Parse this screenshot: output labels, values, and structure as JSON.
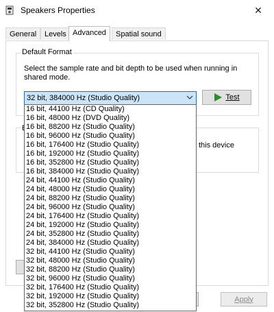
{
  "window": {
    "title": "Speakers Properties",
    "close_glyph": "✕"
  },
  "tabs": [
    {
      "label": "General"
    },
    {
      "label": "Levels"
    },
    {
      "label": "Advanced"
    },
    {
      "label": "Spatial sound"
    }
  ],
  "default_format": {
    "legend": "Default Format",
    "description": "Select the sample rate and bit depth to be used when running in shared mode.",
    "selected": "32 bit, 384000 Hz (Studio Quality)",
    "test_label": "Test"
  },
  "hidden_text": {
    "peek_char": "E",
    "exclusive_fragment": "this device"
  },
  "format_options": [
    "16 bit, 44100 Hz (CD Quality)",
    "16 bit, 48000 Hz (DVD Quality)",
    "16 bit, 88200 Hz (Studio Quality)",
    "16 bit, 96000 Hz (Studio Quality)",
    "16 bit, 176400 Hz (Studio Quality)",
    "16 bit, 192000 Hz (Studio Quality)",
    "16 bit, 352800 Hz (Studio Quality)",
    "16 bit, 384000 Hz (Studio Quality)",
    "24 bit, 44100 Hz (Studio Quality)",
    "24 bit, 48000 Hz (Studio Quality)",
    "24 bit, 88200 Hz (Studio Quality)",
    "24 bit, 96000 Hz (Studio Quality)",
    "24 bit, 176400 Hz (Studio Quality)",
    "24 bit, 192000 Hz (Studio Quality)",
    "24 bit, 352800 Hz (Studio Quality)",
    "24 bit, 384000 Hz (Studio Quality)",
    "32 bit, 44100 Hz (Studio Quality)",
    "32 bit, 48000 Hz (Studio Quality)",
    "32 bit, 88200 Hz (Studio Quality)",
    "32 bit, 96000 Hz (Studio Quality)",
    "32 bit, 176400 Hz (Studio Quality)",
    "32 bit, 192000 Hz (Studio Quality)",
    "32 bit, 352800 Hz (Studio Quality)"
  ],
  "footer": {
    "apply_label": "Apply"
  },
  "icons": {
    "app": "speaker-properties-icon",
    "close": "close-icon",
    "dropdown": "chevron-down-icon",
    "test": "play-icon"
  },
  "colors": {
    "play_green": "#2e8b2e",
    "selection_blue": "#cce4f7",
    "focus_border": "#0078d7"
  }
}
